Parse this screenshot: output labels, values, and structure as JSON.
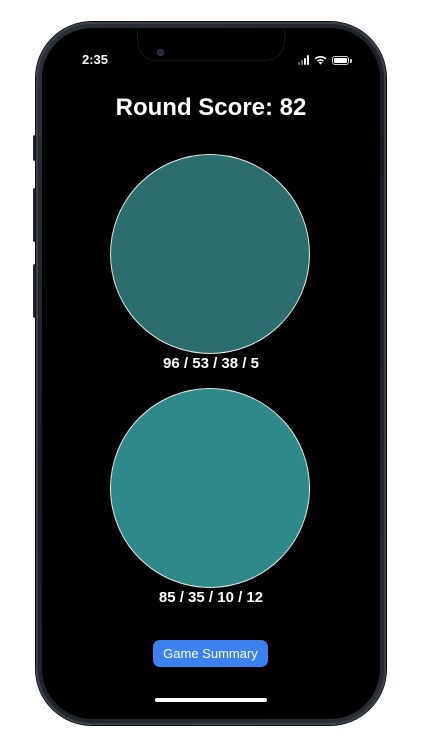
{
  "status_bar": {
    "time": "2:35",
    "icons": [
      "cellular-signal-icon",
      "wifi-icon",
      "battery-icon"
    ]
  },
  "game": {
    "round_score_text": "Round Score: 82",
    "target_color": {
      "label": "96 / 53 / 38 / 5",
      "hex": "#2a6f6d"
    },
    "guess_color": {
      "label": "85 / 35 / 10 / 12",
      "hex": "#2e8a89"
    },
    "summary_button_label": "Game Summary"
  },
  "colors": {
    "screen_background": "#000000",
    "button_accent": "#3b82f0",
    "text": "#ffffff"
  }
}
